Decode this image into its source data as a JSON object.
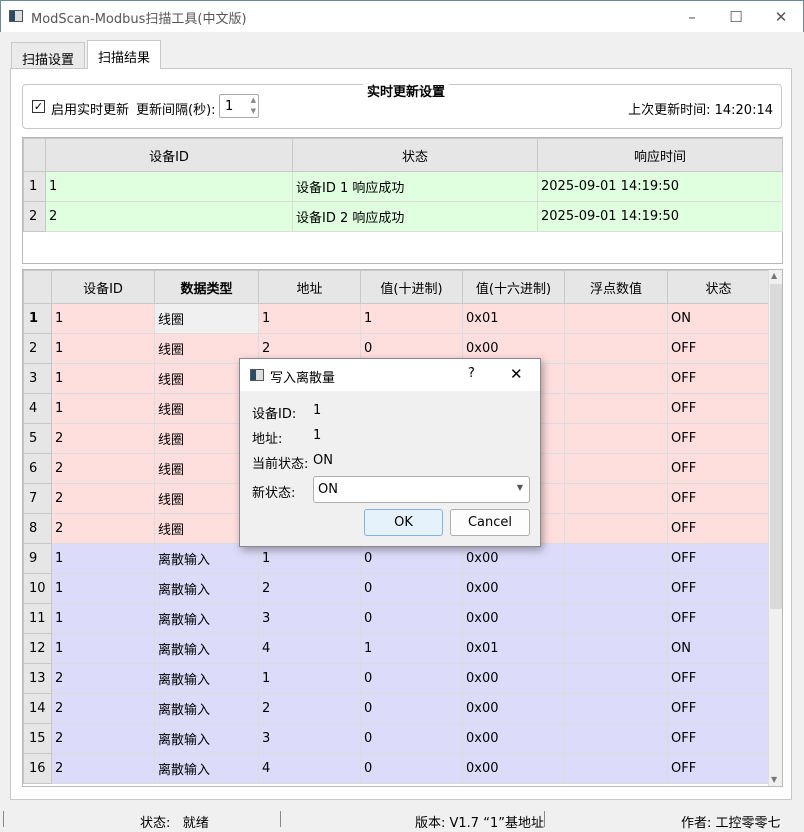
{
  "window": {
    "title": "ModScan-Modbus扫描工具(中文版)",
    "minimize": "–",
    "maximize": "☐",
    "close": "✕"
  },
  "tabs": [
    {
      "label": "扫描设置"
    },
    {
      "label": "扫描结果",
      "active": true
    }
  ],
  "realtime": {
    "group_title": "实时更新设置",
    "enable_label": "启用实时更新",
    "enabled": true,
    "interval_label": "更新间隔(秒):",
    "interval_value": "1",
    "last_update": "上次更新时间: 14:20:14"
  },
  "device_table": {
    "headers": [
      "设备ID",
      "状态",
      "响应时间"
    ],
    "rows": [
      [
        "1",
        "设备ID 1 响应成功",
        "2025-09-01 14:19:50"
      ],
      [
        "2",
        "设备ID 2 响应成功",
        "2025-09-01 14:19:50"
      ]
    ],
    "row_color": "#dfffdf"
  },
  "data_table": {
    "headers": [
      "设备ID",
      "数据类型",
      "地址",
      "值(十进制)",
      "值(十六进制)",
      "浮点数值",
      "状态"
    ],
    "colors": {
      "coil": "#ffdede",
      "discrete": "#dcdcfa"
    },
    "rows": [
      [
        "1",
        "线圈",
        "1",
        "1",
        "0x01",
        "",
        "ON"
      ],
      [
        "1",
        "线圈",
        "2",
        "0",
        "0x00",
        "",
        "OFF"
      ],
      [
        "1",
        "线圈",
        "",
        "",
        "",
        "",
        "OFF"
      ],
      [
        "1",
        "线圈",
        "",
        "",
        "",
        "",
        "OFF"
      ],
      [
        "2",
        "线圈",
        "",
        "",
        "",
        "",
        "OFF"
      ],
      [
        "2",
        "线圈",
        "",
        "",
        "",
        "",
        "OFF"
      ],
      [
        "2",
        "线圈",
        "",
        "",
        "",
        "",
        "OFF"
      ],
      [
        "2",
        "线圈",
        "",
        "",
        "",
        "",
        "OFF"
      ],
      [
        "1",
        "离散输入",
        "1",
        "0",
        "0x00",
        "",
        "OFF"
      ],
      [
        "1",
        "离散输入",
        "2",
        "0",
        "0x00",
        "",
        "OFF"
      ],
      [
        "1",
        "离散输入",
        "3",
        "0",
        "0x00",
        "",
        "OFF"
      ],
      [
        "1",
        "离散输入",
        "4",
        "1",
        "0x01",
        "",
        "ON"
      ],
      [
        "2",
        "离散输入",
        "1",
        "0",
        "0x00",
        "",
        "OFF"
      ],
      [
        "2",
        "离散输入",
        "2",
        "0",
        "0x00",
        "",
        "OFF"
      ],
      [
        "2",
        "离散输入",
        "3",
        "0",
        "0x00",
        "",
        "OFF"
      ],
      [
        "2",
        "离散输入",
        "4",
        "0",
        "0x00",
        "",
        "OFF"
      ]
    ]
  },
  "dialog": {
    "title": "写入离散量",
    "help": "?",
    "close": "✕",
    "device_label": "设备ID:",
    "device_value": "1",
    "address_label": "地址:",
    "address_value": "1",
    "current_label": "当前状态:",
    "current_value": "ON",
    "new_label": "新状态:",
    "new_value": "ON",
    "ok": "OK",
    "cancel": "Cancel"
  },
  "statusbar": {
    "status": "状态:   就绪",
    "version": "版本: V1.7 “1”基地址",
    "author": "作者: 工控零零七"
  }
}
